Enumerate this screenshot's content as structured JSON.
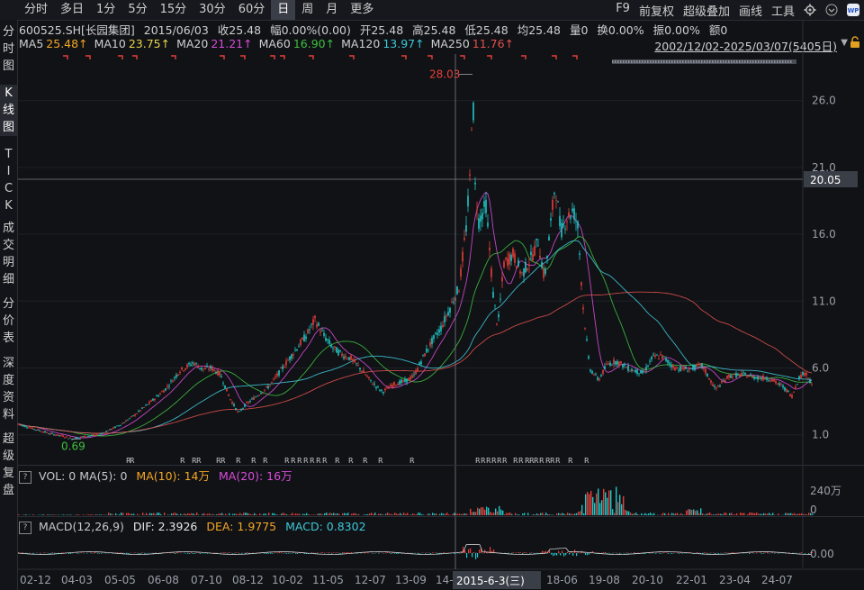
{
  "toolbar": {
    "periods": [
      "分时",
      "多日",
      "1分",
      "5分",
      "15分",
      "30分",
      "60分",
      "日",
      "周",
      "月",
      "更多"
    ],
    "active_period": "日",
    "tools": [
      "F9",
      "前复权",
      "超级叠加",
      "画线",
      "工具"
    ],
    "settings_icon": "gear-icon",
    "logo_icon": "wp-logo-icon"
  },
  "sidebar": {
    "items": [
      "分时图",
      "K线图",
      "TICK",
      "成交明细",
      "分价表",
      "深度资料",
      "超级复盘"
    ],
    "active": "K线图"
  },
  "quote": {
    "code": "600525.SH[长园集团]",
    "date": "2015/06/03",
    "close": "收25.48",
    "change": "幅0.00%(0.00)",
    "open": "开25.48",
    "high": "高25.48",
    "low": "低25.48",
    "avg": "均25.48",
    "volume": "量0",
    "turnover": "换0.00%",
    "amplitude": "振0.00%",
    "amount": "额0"
  },
  "ma_legend": [
    {
      "label": "MA5",
      "value": "25.48↑",
      "color": "#f5a623"
    },
    {
      "label": "MA10",
      "value": "23.75↑",
      "color": "#e8d44d"
    },
    {
      "label": "MA20",
      "value": "21.21↑",
      "color": "#d84bd8"
    },
    {
      "label": "MA60",
      "value": "16.90↑",
      "color": "#3fbf3f"
    },
    {
      "label": "MA120",
      "value": "13.97↑",
      "color": "#3fc8d8"
    },
    {
      "label": "MA250",
      "value": "11.76↑",
      "color": "#e0504d"
    }
  ],
  "range_text": "2002/12/02-2025/03/07(5405日)",
  "volume_legend": {
    "prefix": "VOL: 0  MA(5): 0",
    "ma10": "MA(10): 14万",
    "ma20": "MA(20): 16万",
    "colors": {
      "ma10": "#f5a623",
      "ma20": "#d84bd8"
    },
    "axis": [
      "240万",
      "0"
    ]
  },
  "macd_legend": {
    "prefix": "MACD(12,26,9)",
    "dif": "DIF: 2.3926",
    "dea": "DEA: 1.9775",
    "macd": "MACD: 0.8302",
    "colors": {
      "dif": "#e6e6e6",
      "dea": "#f5a623",
      "macd": "#3fc8d8"
    },
    "axis": [
      "0.00"
    ]
  },
  "crosshair": {
    "date_label": "2015-6-3(三)",
    "price_label": "20.05"
  },
  "annotations": {
    "high": "28.03",
    "low": "0.69",
    "event_marker": "R"
  },
  "colors": {
    "up": "#e8403a",
    "down": "#21c7c7",
    "background": "#101216",
    "grid": "#1e2127",
    "crosshair": "#7a7e86"
  },
  "chart_data": {
    "type": "candlestick",
    "title": "600525.SH 长园集团 日K",
    "x_ticks": [
      "02-12",
      "04-03",
      "05-05",
      "06-08",
      "07-10",
      "08-12",
      "10-02",
      "11-05",
      "12-07",
      "13-09",
      "14-",
      "15-",
      "18-06",
      "19-08",
      "20-10",
      "22-01",
      "23-04",
      "24-07"
    ],
    "y_ticks": [
      "1.0",
      "6.0",
      "11.0",
      "16.0",
      "21.0",
      "26.0"
    ],
    "ylim": [
      -0.5,
      28.8
    ],
    "price_series": {
      "name": "close",
      "points": [
        [
          0,
          1.8
        ],
        [
          10,
          1.6
        ],
        [
          20,
          1.4
        ],
        [
          35,
          1.1
        ],
        [
          50,
          0.9
        ],
        [
          60,
          0.7
        ],
        [
          75,
          0.9
        ],
        [
          90,
          1.0
        ],
        [
          100,
          1.3
        ],
        [
          115,
          1.8
        ],
        [
          130,
          2.5
        ],
        [
          150,
          3.6
        ],
        [
          165,
          4.5
        ],
        [
          180,
          5.8
        ],
        [
          195,
          6.4
        ],
        [
          205,
          5.9
        ],
        [
          215,
          6.0
        ],
        [
          225,
          5.5
        ],
        [
          235,
          3.8
        ],
        [
          245,
          2.6
        ],
        [
          252,
          3.2
        ],
        [
          265,
          3.9
        ],
        [
          280,
          4.7
        ],
        [
          295,
          6.1
        ],
        [
          310,
          7.5
        ],
        [
          320,
          8.4
        ],
        [
          330,
          9.6
        ],
        [
          340,
          8.4
        ],
        [
          350,
          7.5
        ],
        [
          360,
          7.0
        ],
        [
          370,
          6.7
        ],
        [
          380,
          6.0
        ],
        [
          392,
          5.0
        ],
        [
          405,
          4.2
        ],
        [
          418,
          4.8
        ],
        [
          430,
          5.0
        ],
        [
          440,
          5.4
        ],
        [
          450,
          6.8
        ],
        [
          460,
          8.0
        ],
        [
          470,
          9.0
        ],
        [
          480,
          10.5
        ],
        [
          490,
          12.0
        ],
        [
          498,
          16.5
        ],
        [
          503,
          21.0
        ],
        [
          505,
          28.0
        ],
        [
          508,
          19.5
        ],
        [
          512,
          17.0
        ],
        [
          520,
          18.2
        ],
        [
          528,
          11.5
        ],
        [
          533,
          9.0
        ],
        [
          540,
          13.8
        ],
        [
          550,
          14.5
        ],
        [
          560,
          13.0
        ],
        [
          570,
          14.2
        ],
        [
          578,
          15.5
        ],
        [
          585,
          12.6
        ],
        [
          592,
          16.8
        ],
        [
          597,
          19.8
        ],
        [
          603,
          16.2
        ],
        [
          610,
          17.2
        ],
        [
          617,
          17.8
        ],
        [
          622,
          16.6
        ],
        [
          628,
          10.5
        ],
        [
          635,
          6.0
        ],
        [
          645,
          5.1
        ],
        [
          655,
          6.3
        ],
        [
          665,
          6.5
        ],
        [
          680,
          5.9
        ],
        [
          695,
          5.6
        ],
        [
          705,
          6.8
        ],
        [
          715,
          6.9
        ],
        [
          730,
          6.0
        ],
        [
          745,
          5.9
        ],
        [
          760,
          6.2
        ],
        [
          775,
          4.4
        ],
        [
          790,
          5.4
        ],
        [
          805,
          5.5
        ],
        [
          820,
          5.3
        ],
        [
          835,
          5.2
        ],
        [
          850,
          4.6
        ],
        [
          860,
          3.9
        ],
        [
          868,
          5.3
        ],
        [
          875,
          5.7
        ],
        [
          882,
          4.8
        ]
      ]
    },
    "ma_series": [
      {
        "name": "MA20",
        "color": "#d84bd8"
      },
      {
        "name": "MA60",
        "color": "#3fbf3f"
      },
      {
        "name": "MA120",
        "color": "#3fc8d8"
      },
      {
        "name": "MA250",
        "color": "#e0504d"
      }
    ]
  }
}
